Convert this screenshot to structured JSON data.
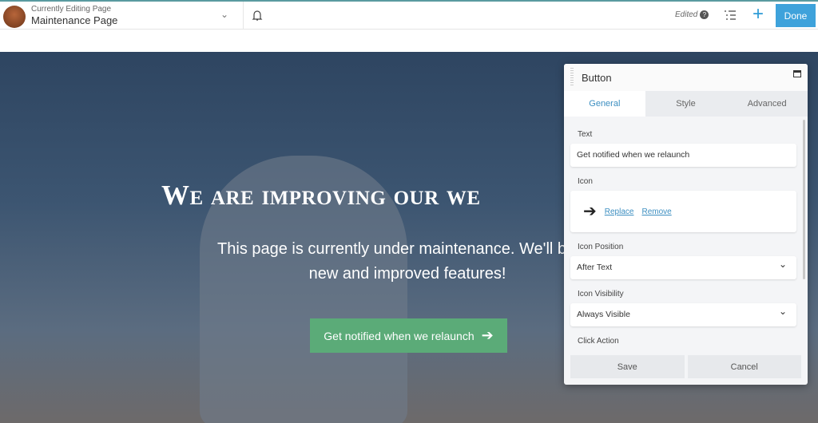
{
  "header": {
    "subtitle": "Currently Editing Page",
    "title": "Maintenance Page",
    "edited": "Edited",
    "help": "?",
    "done": "Done",
    "add": "+"
  },
  "hero": {
    "heading": "We are improving our we",
    "text": "This page is currently under maintenance. We'll be ba",
    "text2": "new and improved features!",
    "button": "Get notified when we relaunch",
    "arrow": "➔"
  },
  "panel": {
    "title": "Button",
    "tabs": [
      "General",
      "Style",
      "Advanced"
    ],
    "active_tab": "General",
    "text_label": "Text",
    "text_value": "Get notified when we relaunch",
    "icon_label": "Icon",
    "icon_glyph": "➔",
    "replace": "Replace",
    "remove": "Remove",
    "pos_label": "Icon Position",
    "pos_value": "After Text",
    "vis_label": "Icon Visibility",
    "vis_value": "Always Visible",
    "click_label": "Click Action",
    "save": "Save",
    "cancel": "Cancel"
  },
  "colors": {
    "accent": "#3ea2db",
    "cta": "#5bab78"
  }
}
